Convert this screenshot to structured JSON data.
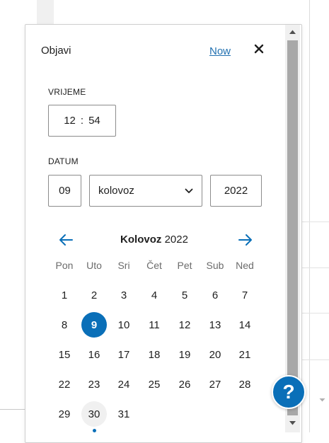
{
  "panel": {
    "title": "Objavi",
    "now_label": "Now",
    "close_icon": "close-icon"
  },
  "time": {
    "label": "VRIJEME",
    "hours": "12",
    "separator": ":",
    "minutes": "54"
  },
  "date": {
    "label": "DATUM",
    "day": "09",
    "month": "kolovoz",
    "year": "2022"
  },
  "calendar": {
    "month_name": "Kolovoz",
    "year": "2022",
    "weekdays": [
      "Pon",
      "Uto",
      "Sri",
      "Čet",
      "Pet",
      "Sub",
      "Ned"
    ],
    "weeks": [
      [
        "1",
        "2",
        "3",
        "4",
        "5",
        "6",
        "7"
      ],
      [
        "8",
        "9",
        "10",
        "11",
        "12",
        "13",
        "14"
      ],
      [
        "15",
        "16",
        "17",
        "18",
        "19",
        "20",
        "21"
      ],
      [
        "22",
        "23",
        "24",
        "25",
        "26",
        "27",
        "28"
      ],
      [
        "29",
        "30",
        "31"
      ]
    ],
    "selected_day": "9",
    "today_day": "30"
  },
  "help": {
    "label": "?"
  },
  "colors": {
    "accent": "#0a6fb8",
    "link": "#2271b1",
    "muted": "#6b6b6b",
    "scroll_thumb": "#a8a8a8"
  }
}
